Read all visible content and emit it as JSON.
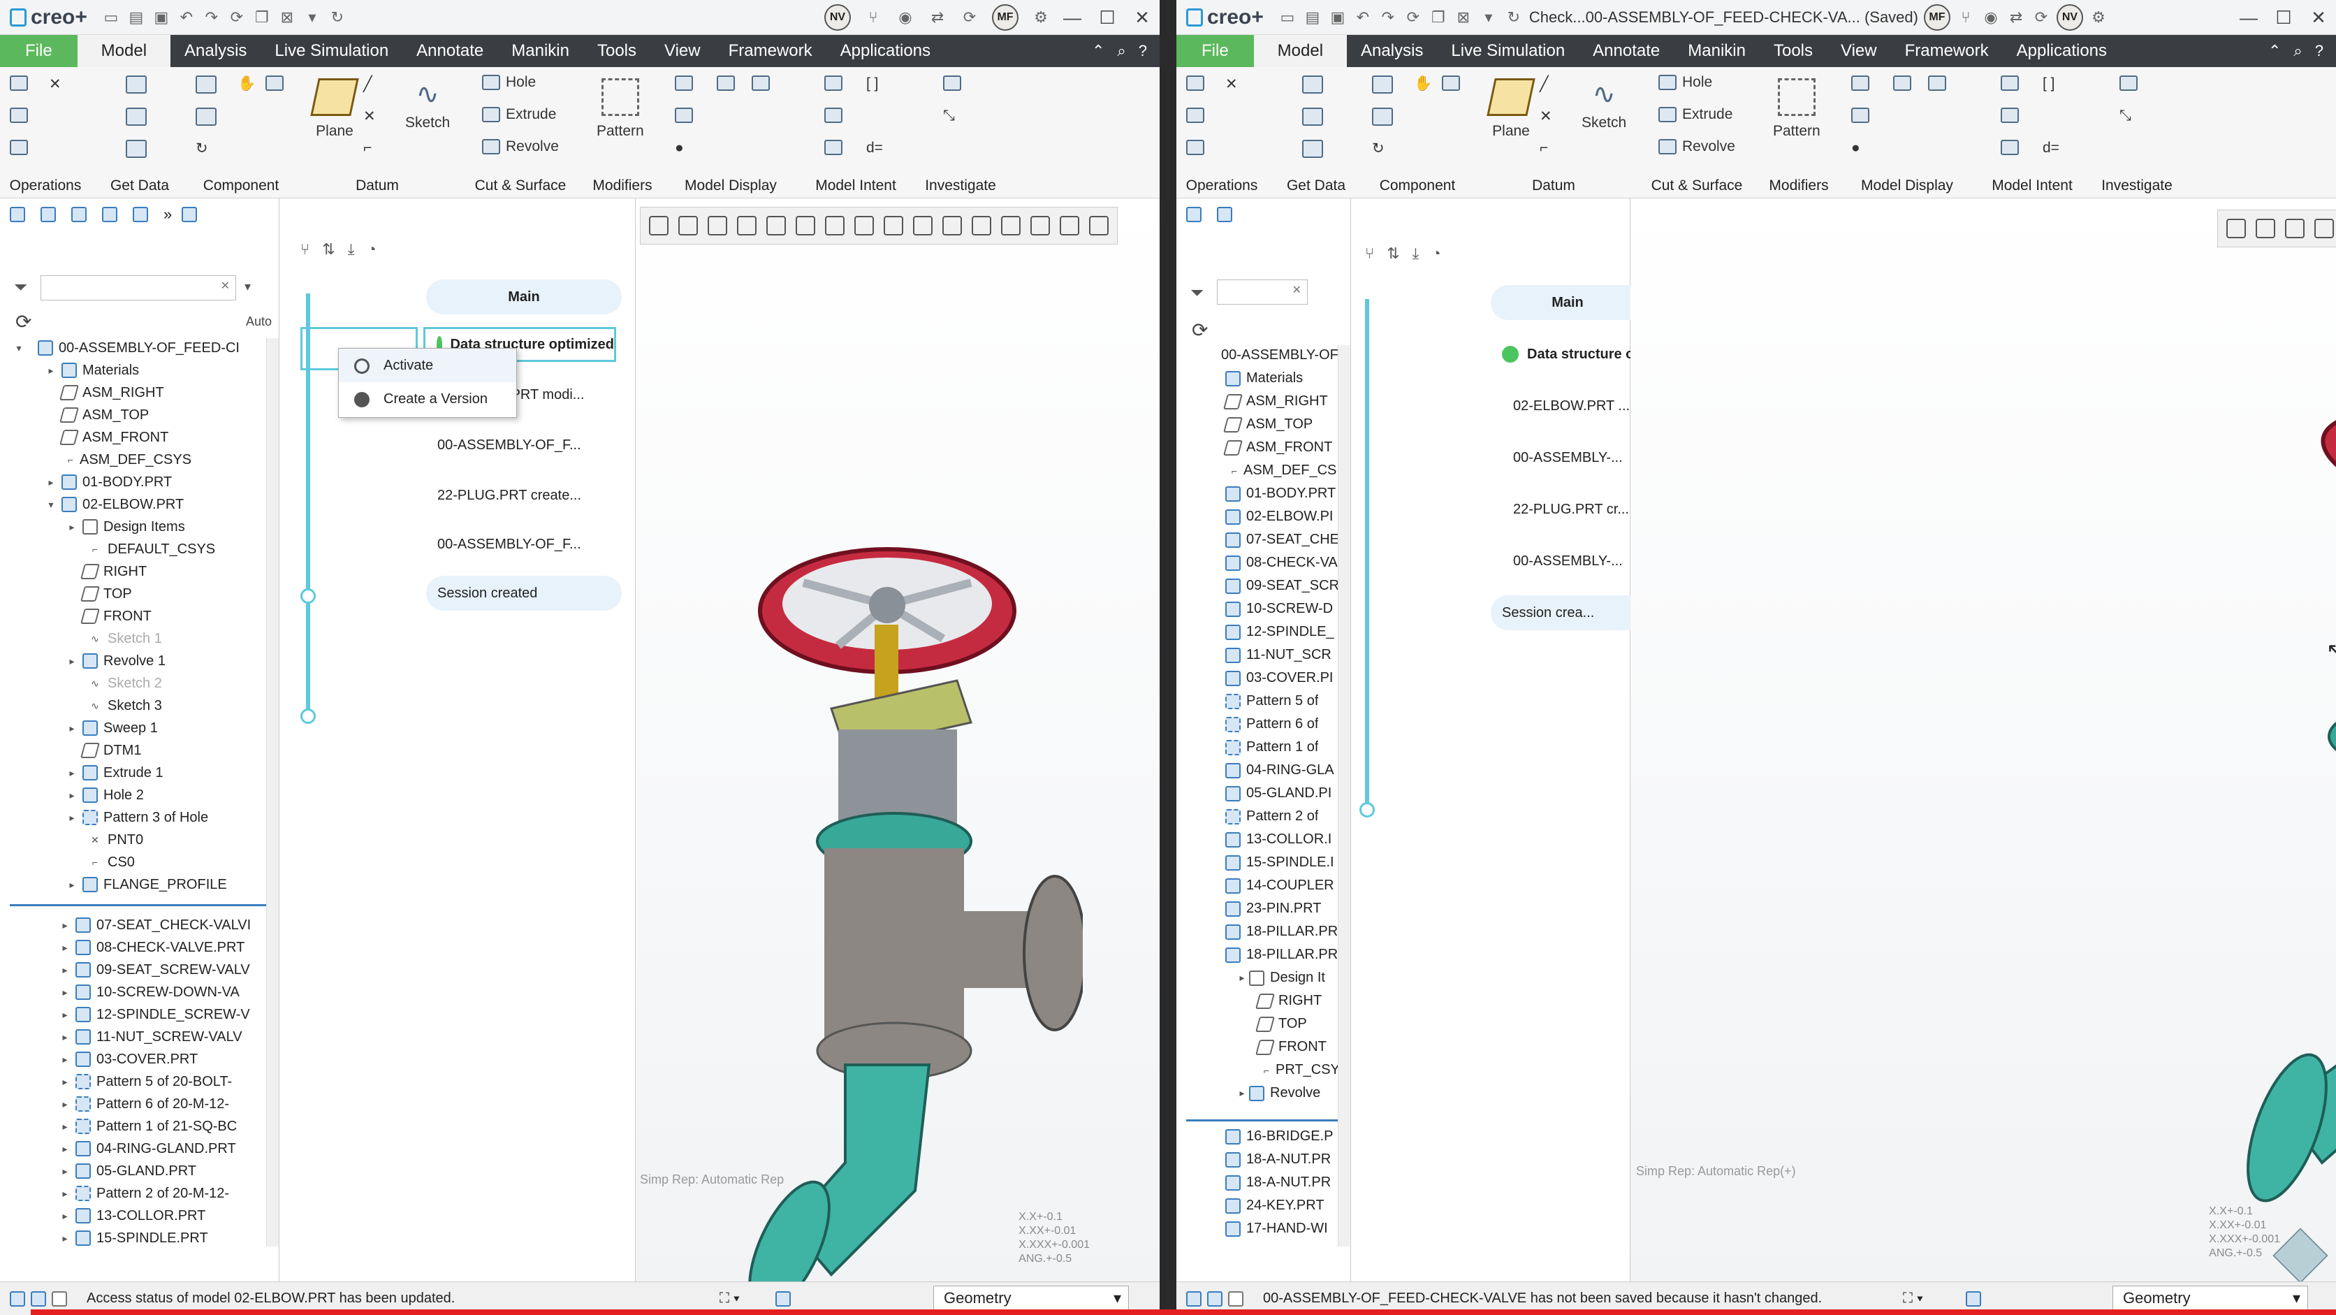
{
  "left": {
    "app_logo": "creo+",
    "avatars": [
      "NV",
      "MF"
    ],
    "menu": {
      "file": "File",
      "tabs": [
        "Model",
        "Analysis",
        "Live Simulation",
        "Annotate",
        "Manikin",
        "Tools",
        "View",
        "Framework",
        "Applications"
      ],
      "active": "Model"
    },
    "ribbon": {
      "groups": [
        "Operations",
        "Get Data",
        "Component",
        "Datum",
        "Cut & Surface",
        "Modifiers",
        "Model Display",
        "Model Intent",
        "Investigate"
      ],
      "buttons": {
        "plane": "Plane",
        "sketch": "Sketch",
        "hole": "Hole",
        "extrude": "Extrude",
        "revolve": "Revolve",
        "pattern": "Pattern"
      }
    },
    "tree_root": "00-ASSEMBLY-OF_FEED-CI",
    "tree_header_col": "Auto",
    "tree": [
      "Materials",
      "ASM_RIGHT",
      "ASM_TOP",
      "ASM_FRONT",
      "ASM_DEF_CSYS",
      "01-BODY.PRT",
      "02-ELBOW.PRT",
      "Design Items",
      "DEFAULT_CSYS",
      "RIGHT",
      "TOP",
      "FRONT",
      "Sketch 1",
      "Revolve 1",
      "Sketch 2",
      "Sketch 3",
      "Sweep 1",
      "DTM1",
      "Extrude 1",
      "Hole 2",
      "Pattern 3 of Hole",
      "PNT0",
      "CS0",
      "FLANGE_PROFILE"
    ],
    "tree2": [
      "07-SEAT_CHECK-VALVI",
      "08-CHECK-VALVE.PRT",
      "09-SEAT_SCREW-VALV",
      "10-SCREW-DOWN-VA",
      "12-SPINDLE_SCREW-V",
      "11-NUT_SCREW-VALV",
      "03-COVER.PRT",
      "Pattern 5 of 20-BOLT-",
      "Pattern 6 of 20-M-12-",
      "Pattern 1 of 21-SQ-BC",
      "04-RING-GLAND.PRT",
      "05-GLAND.PRT",
      "Pattern 2 of 20-M-12-",
      "13-COLLOR.PRT",
      "15-SPINDLE.PRT"
    ],
    "timeline": {
      "main": "Main",
      "events": [
        "Data structure optimized",
        "02-ELBOW.PRT modi...",
        "00-ASSEMBLY-OF_F...",
        "22-PLUG.PRT create...",
        "00-ASSEMBLY-OF_F...",
        "Session created"
      ]
    },
    "context_menu": [
      "Activate",
      "Create a Version"
    ],
    "simp_rep": "Simp Rep: Automatic Rep",
    "coords": [
      "X.X+-0.1",
      "X.XX+-0.01",
      "X.XXX+-0.001",
      "ANG.+-0.5"
    ],
    "status": "Access status of model 02-ELBOW.PRT has been updated.",
    "select_filter": "Geometry"
  },
  "right": {
    "app_logo": "creo+",
    "window_title": "Check...00-ASSEMBLY-OF_FEED-CHECK-VA... (Saved)",
    "avatars": [
      "MF",
      "NV"
    ],
    "menu": {
      "file": "File",
      "tabs": [
        "Model",
        "Analysis",
        "Live Simulation",
        "Annotate",
        "Manikin",
        "Tools",
        "View",
        "Framework",
        "Applications"
      ],
      "active": "Model"
    },
    "ribbon": {
      "groups": [
        "Operations",
        "Get Data",
        "Component",
        "Datum",
        "Cut & Surface",
        "Modifiers",
        "Model Display",
        "Model Intent",
        "Investigate"
      ],
      "buttons": {
        "plane": "Plane",
        "sketch": "Sketch",
        "hole": "Hole",
        "extrude": "Extrude",
        "revolve": "Revolve",
        "pattern": "Pattern"
      }
    },
    "tree_root": "00-ASSEMBLY-OF",
    "tree": [
      "Materials",
      "ASM_RIGHT",
      "ASM_TOP",
      "ASM_FRONT",
      "ASM_DEF_CS",
      "01-BODY.PRT",
      "02-ELBOW.PI",
      "07-SEAT_CHE",
      "08-CHECK-VA",
      "09-SEAT_SCR",
      "10-SCREW-D",
      "12-SPINDLE_",
      "11-NUT_SCR",
      "03-COVER.PI",
      "Pattern 5 of",
      "Pattern 6 of",
      "Pattern 1 of",
      "04-RING-GLA",
      "05-GLAND.PI",
      "Pattern 2 of",
      "13-COLLOR.I",
      "15-SPINDLE.I",
      "14-COUPLER",
      "23-PIN.PRT",
      "18-PILLAR.PR",
      "18-PILLAR.PR",
      "Design It",
      "RIGHT",
      "TOP",
      "FRONT",
      "PRT_CSY:",
      "Revolve"
    ],
    "tree2": [
      "16-BRIDGE.P",
      "18-A-NUT.PR",
      "18-A-NUT.PR",
      "24-KEY.PRT",
      "17-HAND-WI"
    ],
    "timeline": {
      "main": "Main",
      "events": [
        "Data structure opti",
        "02-ELBOW.PRT ...",
        "00-ASSEMBLY-...",
        "22-PLUG.PRT cr...",
        "00-ASSEMBLY-...",
        "Session crea..."
      ]
    },
    "simp_rep": "Simp Rep: Automatic Rep(+)",
    "coords": [
      "X.X+-0.1",
      "X.XX+-0.01",
      "X.XXX+-0.001",
      "ANG.+-0.5"
    ],
    "status": "00-ASSEMBLY-OF_FEED-CHECK-VALVE has not been saved because it hasn't changed.",
    "select_filter": "Geometry"
  }
}
